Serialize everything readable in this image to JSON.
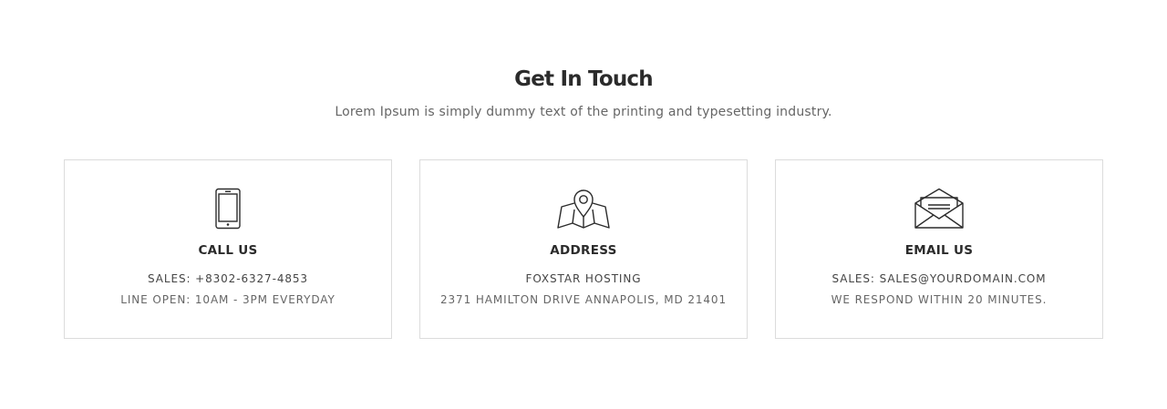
{
  "section": {
    "title": "Get In Touch",
    "subtitle": "Lorem Ipsum is simply dummy text of the printing and typesetting industry."
  },
  "cards": [
    {
      "icon": "smartphone-icon",
      "title": "CALL US",
      "line1": "SALES: +8302-6327-4853",
      "line2": "LINE OPEN: 10AM - 3PM EVERYDAY"
    },
    {
      "icon": "map-pin-icon",
      "title": "ADDRESS",
      "line1": "FOXSTAR HOSTING",
      "line2": "2371 HAMILTON DRIVE ANNAPOLIS, MD 21401"
    },
    {
      "icon": "envelope-open-icon",
      "title": "EMAIL US",
      "line1": "SALES: SALES@YOURDOMAIN.COM",
      "line2": "WE RESPOND WITHIN 20 MINUTES."
    }
  ],
  "colors": {
    "heading": "#2b2b2b",
    "text": "#666666",
    "border": "#dcdcdc",
    "icon_stroke": "#2b2b2b"
  }
}
